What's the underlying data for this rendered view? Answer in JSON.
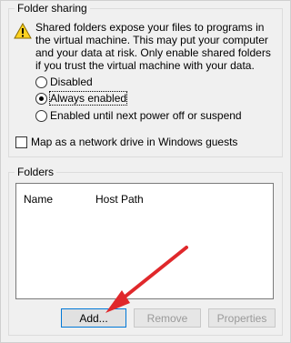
{
  "folder_sharing": {
    "legend": "Folder sharing",
    "warning_icon": "warning-icon",
    "warning_text": "Shared folders expose your files to programs in the virtual machine. This may put your computer and your data at risk. Only enable shared folders if you trust the virtual machine with your data.",
    "options": [
      {
        "label": "Disabled",
        "checked": false
      },
      {
        "label": "Always enabled",
        "checked": true
      },
      {
        "label": "Enabled until next power off or suspend",
        "checked": false
      }
    ],
    "map_network_drive": {
      "label": "Map as a network drive in Windows guests",
      "checked": false
    }
  },
  "folders": {
    "legend": "Folders",
    "columns": [
      "Name",
      "Host Path"
    ],
    "rows": []
  },
  "buttons": {
    "add": "Add...",
    "remove": "Remove",
    "properties": "Properties"
  },
  "colors": {
    "annotation_arrow": "#e0282b",
    "warning_yellow": "#ffd21f"
  }
}
